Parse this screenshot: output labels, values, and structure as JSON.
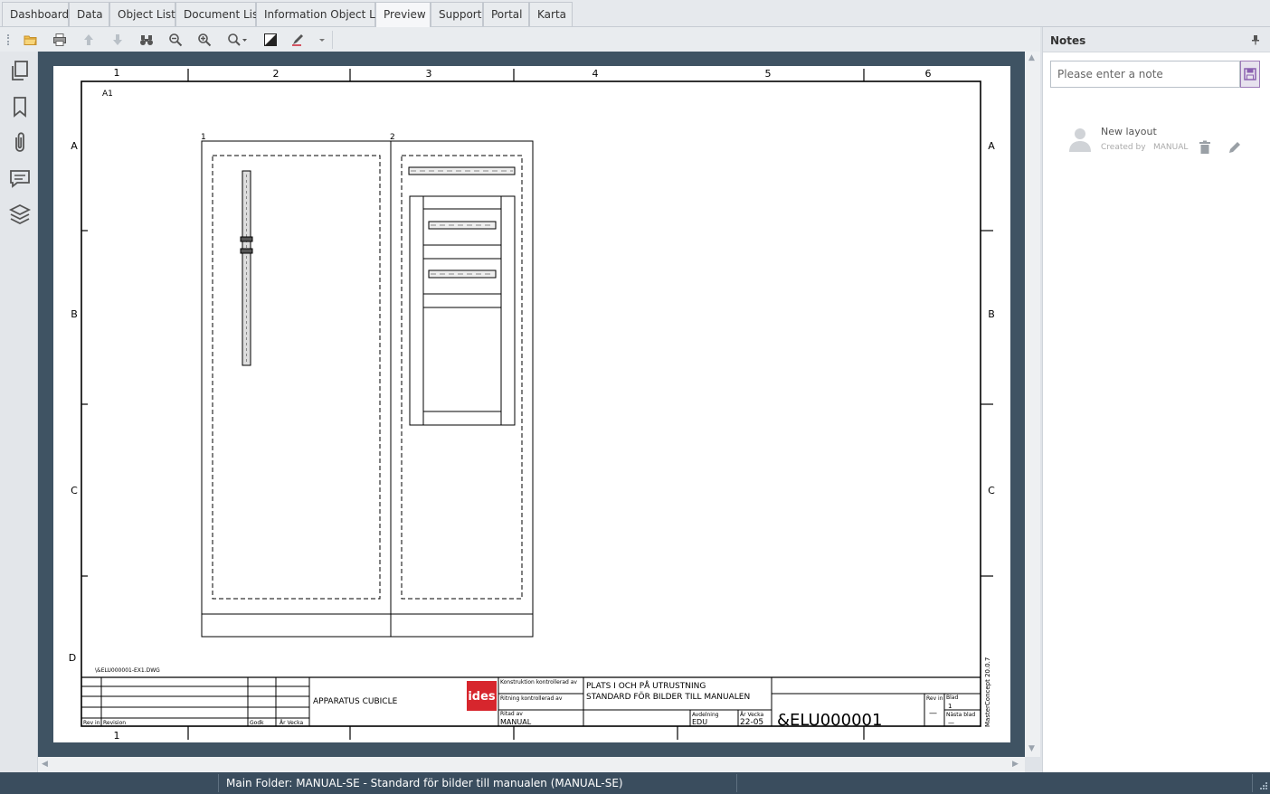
{
  "tabs": [
    {
      "label": "Dashboard"
    },
    {
      "label": "Data"
    },
    {
      "label": "Object List"
    },
    {
      "label": "Document List"
    },
    {
      "label": "Information Object List"
    },
    {
      "label": "Preview",
      "active": true
    },
    {
      "label": "Support"
    },
    {
      "label": "Portal"
    },
    {
      "label": "Karta"
    }
  ],
  "toolbar": {
    "icons": [
      "open-folder-icon",
      "print-icon",
      "arrow-up-icon",
      "arrow-down-icon",
      "binoculars-icon",
      "zoom-out-icon",
      "zoom-in-icon",
      "zoom-dropdown-icon",
      "contrast-icon",
      "markup-pen-icon"
    ]
  },
  "sidebar": {
    "icons": [
      "pages-icon",
      "bookmark-icon",
      "attachment-icon",
      "comment-icon",
      "layers-icon"
    ]
  },
  "drawing": {
    "col_labels": [
      "1",
      "2",
      "3",
      "4",
      "5",
      "6"
    ],
    "row_labels": [
      "A",
      "B",
      "C",
      "D"
    ],
    "sheet_ref": "A1",
    "cabinet_1_label": "1",
    "cabinet_2_label": "2",
    "file_ref": "\\&ELU000001-EX1.DWG",
    "title_block": {
      "title": "APPARATUS CUBICLE",
      "logo": "ides",
      "rev_in": "Rev in",
      "revision": "Revision",
      "godk": "Godk",
      "ar_vecka": "År Vecka",
      "konstruktion": "Konstruktion kontrollerad av",
      "ritning": "Ritning kontrollerad av",
      "ritad_av": "Ritad av",
      "ritad_av_value": "MANUAL",
      "description_line1": "PLATS I OCH PÅ UTRUSTNING",
      "description_line2": "STANDARD FÖR BILDER TILL MANUALEN",
      "avdelning": "Avdelning",
      "avdelning_value": "EDU",
      "ar_vecka_2": "År Vecka",
      "ar_vecka_value": "22-05",
      "doc_number": "&ELU000001",
      "rev_in_2": "Rev in",
      "dash": "—",
      "blad": "Blad",
      "blad_value": "1",
      "nasta_blad": "Nästa blad",
      "nasta_blad_value": "—",
      "master_concept": "MasterConcept 20.0.7"
    }
  },
  "notes": {
    "title": "Notes",
    "input_placeholder": "Please enter a note",
    "items": [
      {
        "title": "New layout",
        "created_by_label": "Created by",
        "created_by": "MANUAL"
      }
    ]
  },
  "status": {
    "text": "Main Folder: MANUAL-SE - Standard för bilder till manualen (MANUAL-SE)"
  },
  "colors": {
    "viewer_bg": "#3f5363",
    "statusbar_bg": "#3a4d5e",
    "logo_red": "#d7262d",
    "save_accent": "#8a5fb0"
  }
}
